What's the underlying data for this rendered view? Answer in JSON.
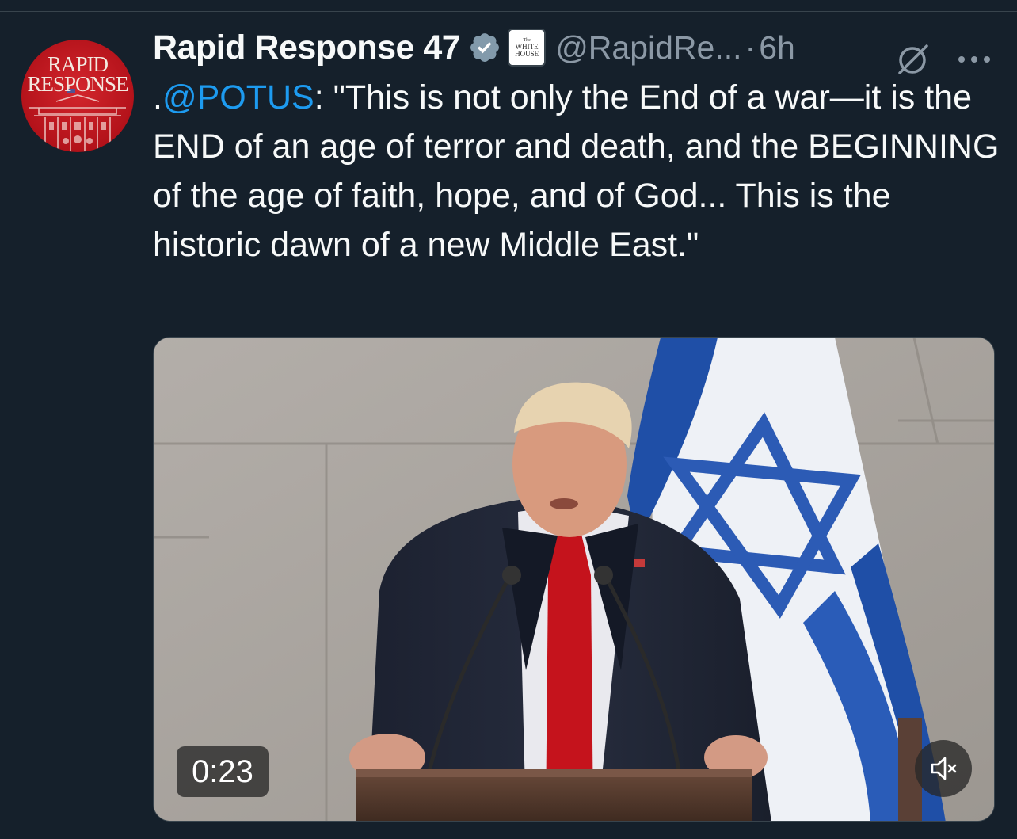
{
  "tweet": {
    "author": {
      "display_name": "Rapid Response 47",
      "handle": "@RapidRe...",
      "avatar_text_line1": "RAPID",
      "avatar_text_line2": "RESPONSE",
      "affiliate_badge_text": [
        "The",
        "WHITE",
        "HOUSE"
      ]
    },
    "separator": "·",
    "timestamp": "6h",
    "text": {
      "prefix": ".",
      "mention": "@POTUS",
      "body": ": \"This is not only the End of a war—it is the END of an age of terror and death, and the BEGINNING of the age of faith, hope, and of God... This is the historic dawn of a new Middle East.\""
    },
    "media": {
      "type": "video",
      "duration": "0:23",
      "muted": true
    }
  },
  "icons": {
    "verified": "verified-badge-icon",
    "grok": "grok-icon",
    "more": "more-options-icon",
    "mute": "volume-muted-icon"
  },
  "colors": {
    "background": "#15202b",
    "mention": "#1d9bf0",
    "secondary_text": "#8b98a5",
    "verified": "#829aab"
  }
}
